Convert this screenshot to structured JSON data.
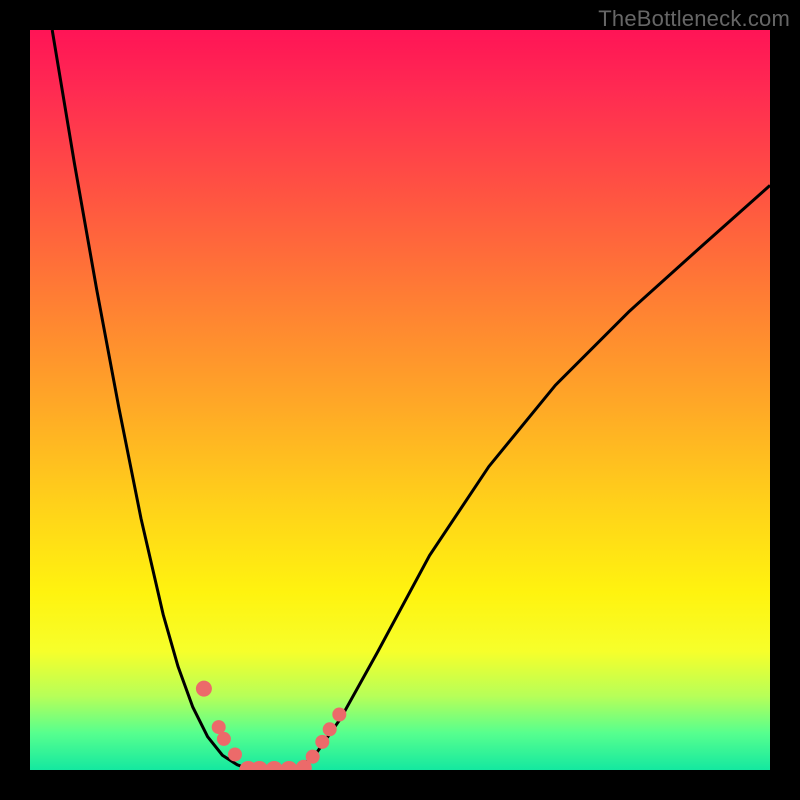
{
  "watermark": "TheBottleneck.com",
  "chart_data": {
    "type": "line",
    "title": "",
    "xlabel": "",
    "ylabel": "",
    "xlim": [
      0,
      1
    ],
    "ylim": [
      0,
      1
    ],
    "curve_left": {
      "x": [
        0.03,
        0.06,
        0.09,
        0.12,
        0.15,
        0.18,
        0.2,
        0.22,
        0.24,
        0.26,
        0.28,
        0.3
      ],
      "y": [
        1.0,
        0.82,
        0.65,
        0.49,
        0.34,
        0.21,
        0.14,
        0.085,
        0.045,
        0.02,
        0.007,
        0.0
      ]
    },
    "curve_right": {
      "x": [
        0.36,
        0.385,
        0.42,
        0.47,
        0.54,
        0.62,
        0.71,
        0.81,
        0.91,
        1.0
      ],
      "y": [
        0.0,
        0.02,
        0.07,
        0.16,
        0.29,
        0.41,
        0.52,
        0.62,
        0.71,
        0.79
      ]
    },
    "markers": [
      {
        "x": 0.235,
        "y": 0.11,
        "r": 8
      },
      {
        "x": 0.255,
        "y": 0.058,
        "r": 7
      },
      {
        "x": 0.262,
        "y": 0.042,
        "r": 7
      },
      {
        "x": 0.277,
        "y": 0.021,
        "r": 7
      },
      {
        "x": 0.295,
        "y": 0.0,
        "r": 9
      },
      {
        "x": 0.31,
        "y": 0.0,
        "r": 9
      },
      {
        "x": 0.33,
        "y": 0.0,
        "r": 9
      },
      {
        "x": 0.35,
        "y": 0.0,
        "r": 9
      },
      {
        "x": 0.37,
        "y": 0.003,
        "r": 8
      },
      {
        "x": 0.382,
        "y": 0.018,
        "r": 7
      },
      {
        "x": 0.395,
        "y": 0.038,
        "r": 7
      },
      {
        "x": 0.405,
        "y": 0.055,
        "r": 7
      },
      {
        "x": 0.418,
        "y": 0.075,
        "r": 7
      }
    ],
    "marker_color": "#ec6a6a",
    "curve_color": "#000000",
    "curve_width": 3
  }
}
